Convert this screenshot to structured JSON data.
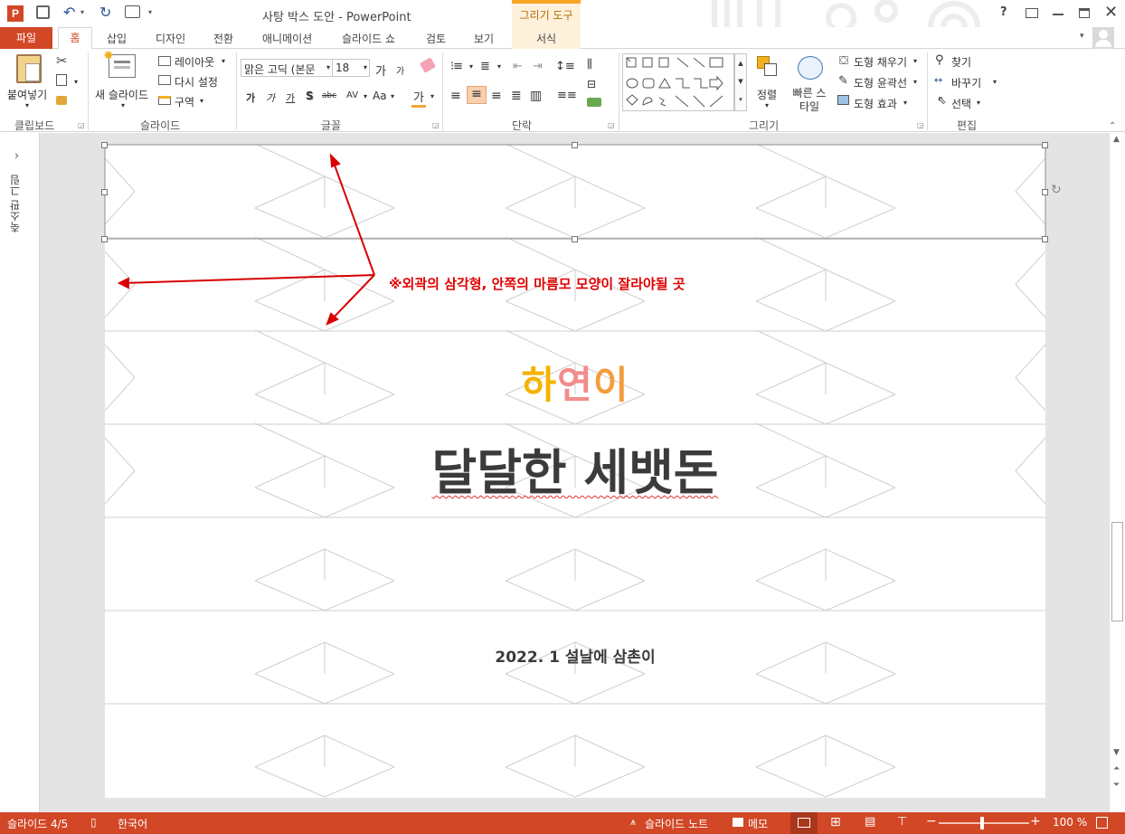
{
  "window": {
    "title": "사탕 박스 도안 - PowerPoint",
    "context_tab_group": "그리기 도구",
    "help_label": "?",
    "colors": {
      "accent": "#d24726",
      "context": "#f5a623",
      "annotation": "#e00000",
      "name_gradient": [
        "#f5b300",
        "#f28c8c",
        "#f49d3b"
      ]
    }
  },
  "tabs": [
    "파일",
    "홈",
    "삽입",
    "디자인",
    "전환",
    "애니메이션",
    "슬라이드 쇼",
    "검토",
    "보기",
    "서식"
  ],
  "ribbon": {
    "clipboard": {
      "paste": "붙여넣기",
      "group": "클립보드"
    },
    "slides": {
      "new_slide": "새 슬라이드",
      "layout": "레이아웃",
      "reset": "다시 설정",
      "section": "구역",
      "group": "슬라이드"
    },
    "font": {
      "name": "맑은 고딕 (본문",
      "size": "18",
      "group": "글꼴",
      "bold": "가",
      "italic": "가",
      "underline": "가",
      "shadow": "S",
      "strike": "abc",
      "spacing": "AV",
      "case": "Aa",
      "color": "가",
      "grow": "가",
      "shrink": "가"
    },
    "paragraph": {
      "group": "단락"
    },
    "drawing": {
      "arrange": "정렬",
      "quick_styles": "빠른 스타일",
      "fill": "도형 채우기",
      "outline": "도형 윤곽선",
      "effects": "도형 효과",
      "group": "그리기"
    },
    "editing": {
      "find": "찾기",
      "replace": "바꾸기",
      "select": "선택",
      "group": "편집"
    }
  },
  "thumbnail_panel": {
    "label": "축소판 그림"
  },
  "slide": {
    "annotation": "※외곽의 삼각형, 안쪽의 마름모 모양이 잘라야될 곳",
    "name_chars": [
      "하",
      "연",
      "이"
    ],
    "title": "달달한 세뱃돈",
    "subtitle": "2022. 1 설날에 삼촌이"
  },
  "status": {
    "slide_position": "슬라이드 4/5",
    "language": "한국어",
    "notes": "슬라이드 노트",
    "comments": "메모",
    "zoom": "100 %"
  }
}
